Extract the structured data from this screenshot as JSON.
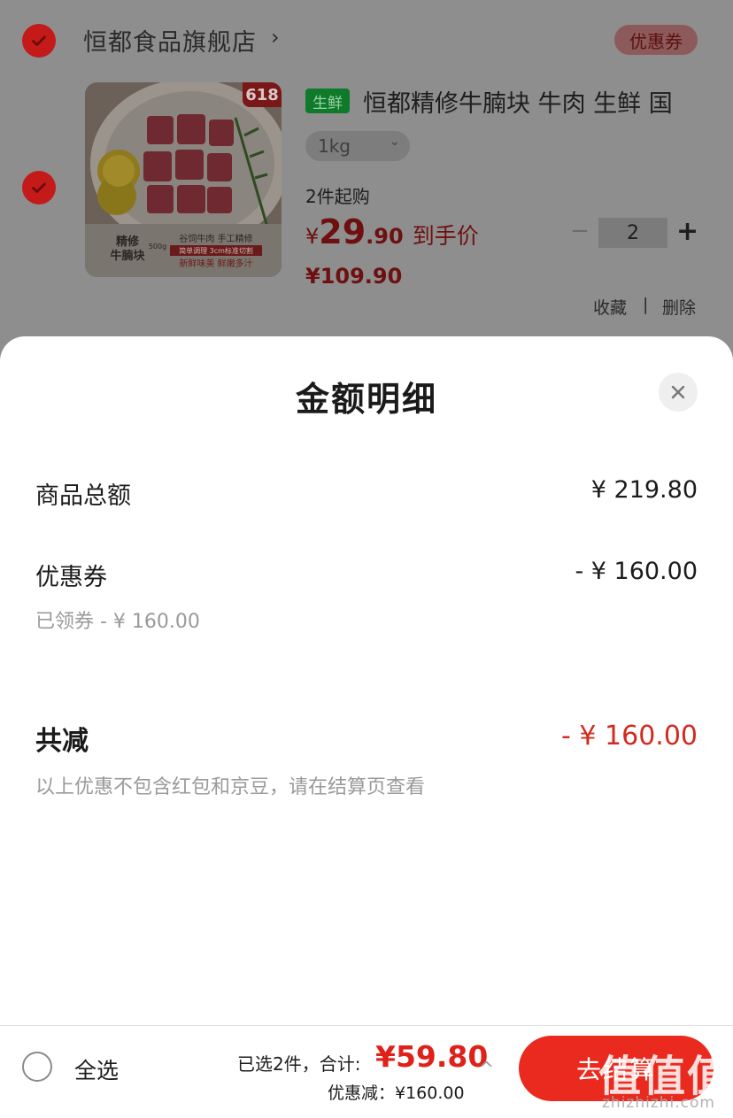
{
  "store": {
    "name": "恒都食品旗舰店",
    "chevron": "›",
    "coupon_tag": "优惠券"
  },
  "product": {
    "badge": "618",
    "fresh_tag": "生鲜",
    "title": "恒都精修牛腩块 牛肉 生鲜 国",
    "spec": "1kg",
    "min_buy": "2件起购",
    "price_symbol": "¥",
    "price_int": "29",
    "price_dec": ".90",
    "price_label": "到手价",
    "original_price": "¥109.90",
    "quantity": "2",
    "minus": "−",
    "plus": "+",
    "favorite": "收藏",
    "separator": "|",
    "delete": "删除",
    "image_text": {
      "left_line1": "精修",
      "left_line2": "牛腩块",
      "weight": "500g",
      "line1": "谷饲牛肉 手工精修",
      "line2": "简单调理 3cm标准切割",
      "line3": "新鲜味美 鲜嫩多汁"
    }
  },
  "sheet": {
    "title": "金额明细",
    "rows": {
      "goods_total_label": "商品总额",
      "goods_total_value": "¥ 219.80",
      "coupon_label": "优惠券",
      "coupon_value": "- ¥ 160.00",
      "coupon_note": "已领券 - ¥ 160.00",
      "total_reduce_label": "共减",
      "total_reduce_value": "- ¥ 160.00",
      "footnote": "以上优惠不包含红包和京豆，请在结算页查看"
    }
  },
  "bottom_bar": {
    "select_all": "全选",
    "selected_text": "已选2件，合计:",
    "total": "¥59.80",
    "discount": "优惠减：¥160.00",
    "checkout": "去结算"
  },
  "watermark": {
    "text": "值值值",
    "url": "zhizhizhi.com"
  },
  "colors": {
    "accent_red": "#e0211a",
    "checkbox_red": "#c41a1a",
    "fresh_green": "#0e7a2a"
  }
}
